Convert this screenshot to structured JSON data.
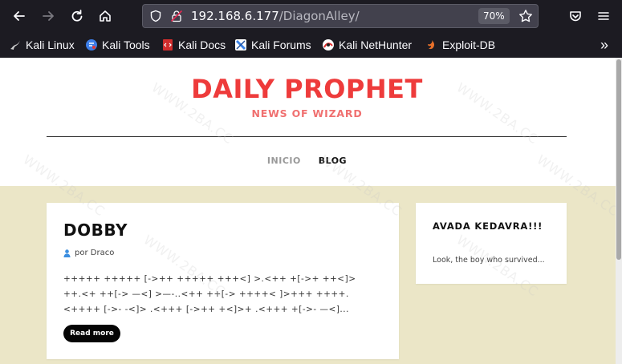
{
  "browser": {
    "url_host": "192.168.6.177",
    "url_path": "/DiagonAlley/",
    "zoom": "70%",
    "bookmarks": [
      {
        "label": "Kali Linux",
        "icon": "kali-dragon-icon",
        "color": "#cfcfcf"
      },
      {
        "label": "Kali Tools",
        "icon": "kali-tools-icon",
        "color": "#3d7ee8"
      },
      {
        "label": "Kali Docs",
        "icon": "kali-docs-icon",
        "color": "#d22d2d"
      },
      {
        "label": "Kali Forums",
        "icon": "kali-forums-icon",
        "color": "#3b82e6"
      },
      {
        "label": "Kali NetHunter",
        "icon": "kali-nethunter-icon",
        "color": "#e03131"
      },
      {
        "label": "Exploit-DB",
        "icon": "exploit-db-icon",
        "color": "#e8702a"
      }
    ],
    "overflow": "»"
  },
  "site": {
    "title": "DAILY PROPHET",
    "tagline": "NEWS OF WIZARD",
    "menu": [
      {
        "label": "INICIO",
        "active": false
      },
      {
        "label": "BLOG",
        "active": true
      }
    ]
  },
  "post": {
    "title": "DOBBY",
    "meta": "por Draco",
    "excerpt_lines": [
      "+++++ +++++ [->++ +++++ +++<] >.<++ +[->+ ++<]>",
      "++.<+ ++[-> —<] >—-..<++ ++[-> ++++< ]>+++ ++++.",
      "<++++ [->- -<]> .<+++ [->++ +<]>+ .<+++ +[->- —<]..."
    ],
    "read_more": "Read more"
  },
  "sidebar": {
    "title": "AVADA KEDAVRA!!!",
    "text": "Look, the boy who survived..."
  },
  "watermark": "WWW.2BA.CC",
  "colors": {
    "title_red": "#ee3b3b",
    "tagline_red": "#f07070",
    "content_bg": "#ebe6c7",
    "chrome_bg": "#1c1b22"
  }
}
